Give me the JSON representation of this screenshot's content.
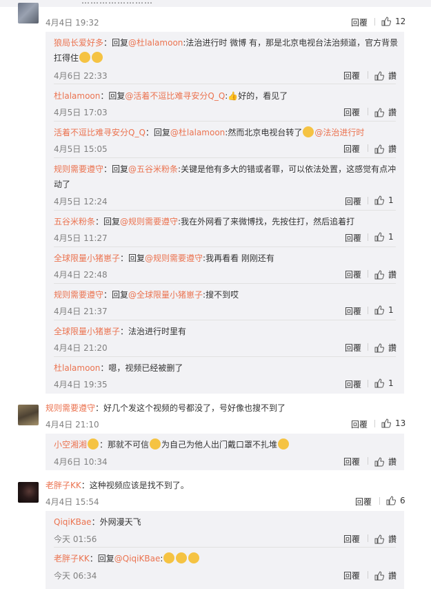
{
  "top_cut_text": "……………………",
  "comments": [
    {
      "time": "4月4日 19:32",
      "reply_label": "回覆",
      "likes": "12"
    },
    {
      "name": "规则需要遵守",
      "text": "：好几个发这个视频的号都没了，号好像也搜不到了",
      "time": "4月4日 21:10",
      "reply_label": "回覆",
      "likes": "13"
    },
    {
      "name": "老胖子KK",
      "text": "：这种视频应该是找不到了。",
      "time": "4月4日 15:54",
      "reply_label": "回覆",
      "likes": "6"
    }
  ],
  "replies": [
    {
      "name": "狼局长爱好多",
      "pre": "：回复",
      "at": "@杜lalamoon",
      "body": ":法治进行时 微博 有，那是北京电视台法治频道，官方背景",
      "body2": "扛得住",
      "time": "4月6日 22:33",
      "reply_label": "回覆",
      "likes": "讚"
    },
    {
      "name": "杜lalamoon",
      "pre": "：回复",
      "at": "@活着不逗比难寻安分Q_Q",
      "body": ":👍好的，看见了",
      "time": "4月5日 17:03",
      "reply_label": "回覆",
      "likes": "讚"
    },
    {
      "name": "活着不逗比难寻安分Q_Q",
      "pre": "：回复",
      "at": "@杜lalamoon",
      "body": ":然而北京电视台转了",
      "at2": "@法治进行时",
      "time": "4月5日 15:05",
      "reply_label": "回覆",
      "likes": "讚"
    },
    {
      "name": "规则需要遵守",
      "pre": "：回复",
      "at": "@五谷米粉条",
      "body": ":关键是他有多大的错或者罪，可以依法处置，这感觉有点冲",
      "body2": "动了",
      "time": "4月5日 12:24",
      "reply_label": "回覆",
      "likes": "1"
    },
    {
      "name": "五谷米粉条",
      "pre": "：回复",
      "at": "@规则需要遵守",
      "body": ":我在外网看了来微博找，先按住打，然后追着打",
      "time": "4月5日 11:27",
      "reply_label": "回覆",
      "likes": "1"
    },
    {
      "name": "全球限量小猪崽子",
      "pre": "：回复",
      "at": "@规则需要遵守",
      "body": ":我再看看 刚刚还有",
      "time": "4月4日 22:48",
      "reply_label": "回覆",
      "likes": "讚"
    },
    {
      "name": "规则需要遵守",
      "pre": "：回复",
      "at": "@全球限量小猪崽子",
      "body": ":搜不到哎",
      "time": "4月4日 21:37",
      "reply_label": "回覆",
      "likes": "1"
    },
    {
      "name": "全球限量小猪崽子",
      "pre": "：",
      "at": "",
      "body": "法治进行时里有",
      "time": "4月4日 21:20",
      "reply_label": "回覆",
      "likes": "讚"
    },
    {
      "name": "杜lalamoon",
      "pre": "：",
      "at": "",
      "body": "嗯，视频已经被删了",
      "time": "4月4日 19:35",
      "reply_label": "回覆",
      "likes": "1"
    },
    {
      "name": "小空湘湘",
      "pre": "：",
      "at": "",
      "body": "那就不可信",
      "body_mid": "为自己为他人出门戴口罩不扎堆",
      "time": "4月6日 10:34",
      "reply_label": "回覆",
      "likes": "讚"
    },
    {
      "name": "QiqiKBae",
      "pre": "：",
      "at": "",
      "body": "外网漫天飞",
      "time": "今天 01:56",
      "reply_label": "回覆",
      "likes": "讚"
    },
    {
      "name": "老胖子KK",
      "pre": "：回复",
      "at": "@QiqiKBae",
      "body": ":",
      "time": "今天 06:34",
      "reply_label": "回覆",
      "likes": "讚"
    }
  ]
}
